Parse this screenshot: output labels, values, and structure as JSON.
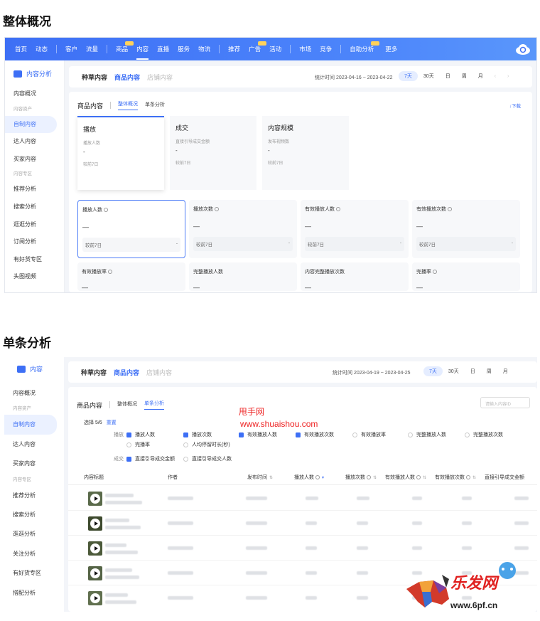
{
  "section1_title": "整体概况",
  "section2_title": "单条分析",
  "topnav": [
    "首页",
    "动态",
    "客户",
    "流量",
    "商品",
    "内容",
    "直播",
    "服务",
    "物流",
    "推荐",
    "广告",
    "活动",
    "市场",
    "竞争",
    "自助分析",
    "更多"
  ],
  "sidebar1": {
    "title": "内容分析",
    "items": [
      "内容概况",
      "内容资产",
      "自制内容",
      "达人内容",
      "买家内容",
      "内容专区",
      "推荐分析",
      "搜索分析",
      "逛逛分析",
      "订阅分析",
      "有好货专区",
      "头图视频"
    ]
  },
  "sidebar2": {
    "title": "内容",
    "items": [
      "内容概况",
      "内容资产",
      "自制内容",
      "达人内容",
      "买家内容",
      "内容专区",
      "推荐分析",
      "搜索分析",
      "逛逛分析",
      "关注分析",
      "有好货专区",
      "搭配分析"
    ]
  },
  "tabs": [
    "种草内容",
    "商品内容",
    "店铺内容"
  ],
  "stat_time1": "统计时间 2023-04-16 ~ 2023-04-22",
  "stat_time2": "统计时间 2023-04-19 ~ 2023-04-25",
  "periods": [
    "7天",
    "30天",
    "日",
    "周",
    "月"
  ],
  "panel_label": "商品内容",
  "subtabs": [
    "整体概况",
    "单条分析"
  ],
  "download": "下载",
  "categories": [
    {
      "title": "播放",
      "sub": "播放人数",
      "value": "-",
      "compare": "较前7日"
    },
    {
      "title": "成交",
      "sub": "直接引导成交金额",
      "value": "-",
      "compare": "较前7日"
    },
    {
      "title": "内容规模",
      "sub": "发布视频数",
      "value": "-",
      "compare": "较前7日"
    }
  ],
  "metrics_row1": [
    {
      "title": "播放人数",
      "value": "—",
      "compare": "较前7日",
      "delta": "-"
    },
    {
      "title": "播放次数",
      "value": "—",
      "compare": "较前7日",
      "delta": "-"
    },
    {
      "title": "有效播放人数",
      "value": "—",
      "compare": "较前7日",
      "delta": "-"
    },
    {
      "title": "有效播放次数",
      "value": "—",
      "compare": "较前7日",
      "delta": "-"
    }
  ],
  "metrics_row2": [
    {
      "title": "有效播放率",
      "value": "—"
    },
    {
      "title": "完整播放人数",
      "value": "—"
    },
    {
      "title": "内容完整播放次数",
      "value": "—"
    },
    {
      "title": "完播率",
      "value": "—"
    }
  ],
  "select_text": "选择 5/6",
  "reset": "重置",
  "group_play": "播放",
  "group_deal": "成交",
  "checks_play": [
    {
      "label": "播放人数",
      "on": true
    },
    {
      "label": "播放次数",
      "on": true
    },
    {
      "label": "有效播放人数",
      "on": true
    },
    {
      "label": "有效播放次数",
      "on": true
    },
    {
      "label": "有效播放率",
      "on": false
    },
    {
      "label": "完整播放人数",
      "on": false
    },
    {
      "label": "完整播放次数",
      "on": false
    },
    {
      "label": "完播率",
      "on": false
    },
    {
      "label": "人均停留时长(秒)",
      "on": false
    }
  ],
  "checks_deal": [
    {
      "label": "直接引导成交金额",
      "on": true
    },
    {
      "label": "直接引导成交人数",
      "on": false
    }
  ],
  "search_placeholder": "请输入内容ID",
  "table_headers": [
    "内容标题",
    "作者",
    "发布时间",
    "播放人数",
    "播放次数",
    "有效播放人数",
    "有效播放次数",
    "直接引导成交金额"
  ],
  "watermark_cn": "甩手网",
  "watermark_url": "www.shuaishou.com",
  "logo_text": "乐发网",
  "logo_url": "www.6pf.cn",
  "colors": {
    "accent": "#3d6ff5",
    "brand_red": "#e0201f"
  }
}
